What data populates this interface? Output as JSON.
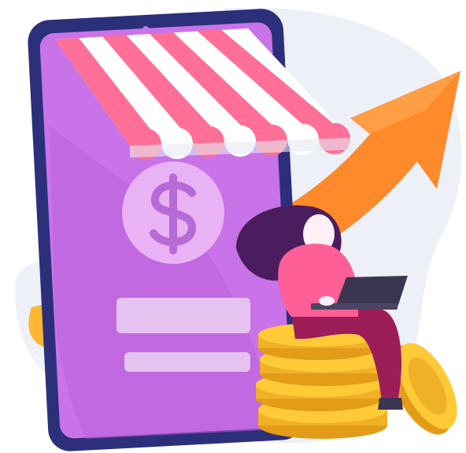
{
  "illustration": {
    "icons": {
      "currency": "dollar-sign-icon",
      "trend": "arrow-up-right-icon",
      "laptop": "laptop-icon",
      "coins": "coin-stack-icon",
      "awning": "shop-awning-icon"
    },
    "colors": {
      "background_blob": "#edf1f7",
      "device_frame": "#2c2f7a",
      "device_screen": "#c973e8",
      "device_screen_dark": "#b961d9",
      "awning_pink": "#ff6f97",
      "awning_white": "#ffffff",
      "dollar_badge": "#e8b2f5",
      "dollar_symbol": "#b66ad6",
      "screen_bar": "#e6c2f1",
      "arrow_orange": "#ff8a2b",
      "arrow_yellow": "#ffb633",
      "woman_hair": "#4c1d5e",
      "woman_skin": "#fff0f5",
      "woman_top": "#ff5f97",
      "woman_pants": "#9d1d58",
      "laptop": "#3a3550",
      "coin": "#ffca37",
      "coin_shadow": "#e29c18",
      "coin_edge": "#f0b126"
    }
  }
}
